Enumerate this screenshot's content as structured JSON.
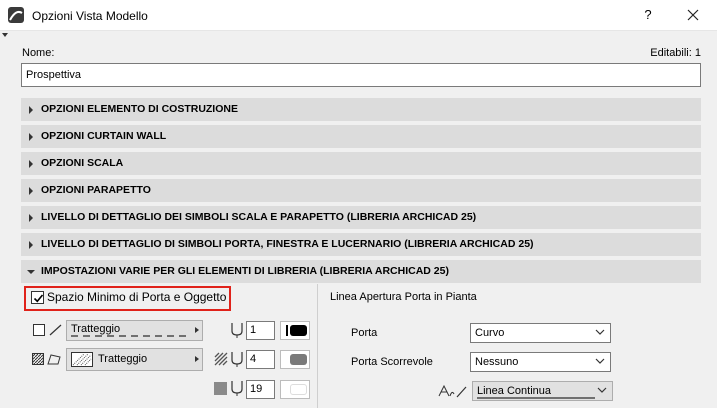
{
  "window": {
    "title": "Opzioni Vista Modello",
    "help_label": "?"
  },
  "nome": {
    "label": "Nome:",
    "value": "Prospettiva",
    "editable_count": "Editabili: 1"
  },
  "sections": [
    "OPZIONI ELEMENTO DI COSTRUZIONE",
    "OPZIONI CURTAIN WALL",
    "OPZIONI SCALA",
    "OPZIONI PARAPETTO",
    "LIVELLO DI DETTAGLIO DEI SIMBOLI SCALA E PARAPETTO (LIBRERIA ARCHICAD 25)",
    "LIVELLO DI DETTAGLIO DI SIMBOLI PORTA, FINESTRA E LUCERNARIO (LIBRERIA ARCHICAD 25)",
    "IMPOSTAZIONI VARIE PER GLI ELEMENTI DI LIBRERIA (LIBRERIA ARCHICAD 25)"
  ],
  "library": {
    "door_clearance_label": "Spazio Minimo di Porta e Oggetto",
    "door_clearance_checked": true,
    "line_type": "Tratteggio",
    "fill_type": "Tratteggio",
    "pen_line": "1",
    "pen_fill_fg": "4",
    "pen_fill_bg": "19",
    "colors": {
      "pen1": "#000000",
      "pen4": "#7a7a7a",
      "pen19": "#ffffff",
      "highlight": "#e0221a"
    },
    "icons": [
      "line-icon",
      "fill-icon",
      "pen-icon",
      "checkbox-checked-icon"
    ]
  },
  "door_opening": {
    "title": "Linea Apertura Porta in Pianta",
    "porta_label": "Porta",
    "porta_value": "Curvo",
    "scorrevole_label": "Porta Scorrevole",
    "scorrevole_value": "Nessuno",
    "line_type_value": "Linea Continua"
  }
}
